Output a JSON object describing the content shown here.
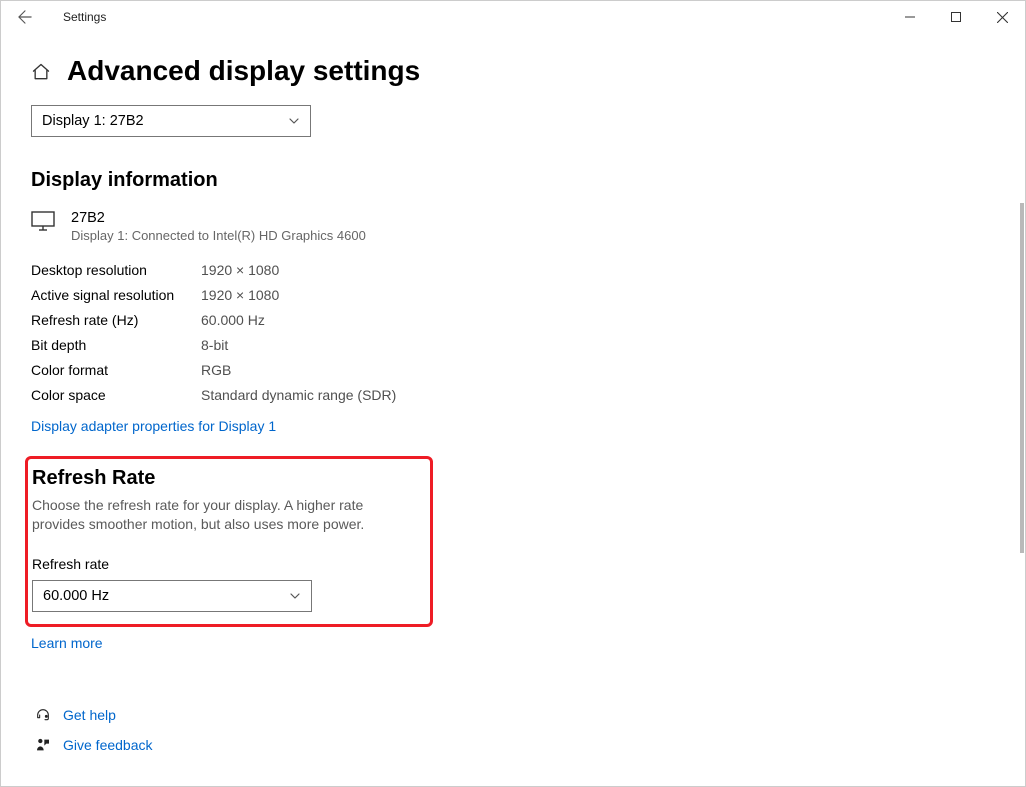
{
  "window": {
    "title": "Settings"
  },
  "page": {
    "title": "Advanced display settings"
  },
  "displaySelect": {
    "selected": "Display 1: 27B2"
  },
  "sections": {
    "displayInfo": {
      "heading": "Display information",
      "monitorName": "27B2",
      "monitorSub": "Display 1: Connected to Intel(R) HD Graphics 4600",
      "rows": {
        "desktopResolution": {
          "key": "Desktop resolution",
          "val": "1920 × 1080"
        },
        "activeSignalResolution": {
          "key": "Active signal resolution",
          "val": "1920 × 1080"
        },
        "refreshRateHz": {
          "key": "Refresh rate (Hz)",
          "val": "60.000 Hz"
        },
        "bitDepth": {
          "key": "Bit depth",
          "val": "8-bit"
        },
        "colorFormat": {
          "key": "Color format",
          "val": "RGB"
        },
        "colorSpace": {
          "key": "Color space",
          "val": "Standard dynamic range (SDR)"
        }
      },
      "adapterLink": "Display adapter properties for Display 1"
    },
    "refreshRate": {
      "heading": "Refresh Rate",
      "description": "Choose the refresh rate for your display. A higher rate provides smoother motion, but also uses more power.",
      "label": "Refresh rate",
      "selected": "60.000 Hz",
      "learnMore": "Learn more"
    }
  },
  "footer": {
    "getHelp": "Get help",
    "giveFeedback": "Give feedback"
  }
}
